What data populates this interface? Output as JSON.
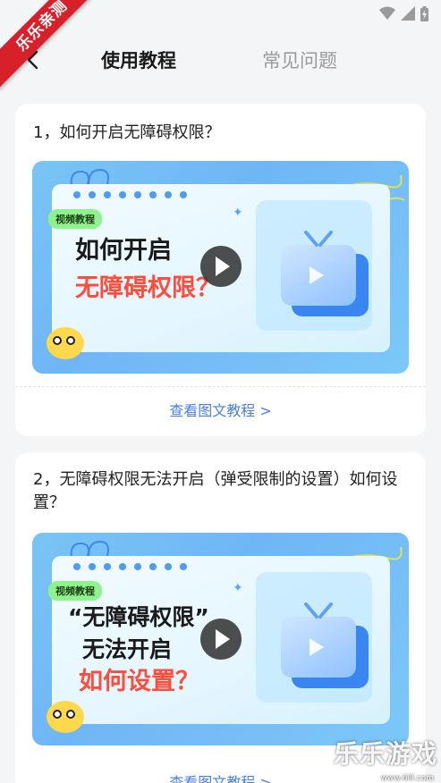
{
  "watermark": {
    "ribbon": "乐乐亲测",
    "bottom_right": "乐乐游戏",
    "bottom_right_url": "www.6ill.com"
  },
  "status_bar": {
    "icons": [
      "wifi-icon",
      "signal-icon",
      "battery-icon"
    ]
  },
  "tabs": [
    {
      "label": "使用教程",
      "active": true
    },
    {
      "label": "常见问题",
      "active": false
    }
  ],
  "cards": [
    {
      "question": "1，如何开启无障碍权限？",
      "thumbnail": {
        "tag": "视频教程",
        "lines": [
          {
            "text": "如何开启",
            "color": "black"
          },
          {
            "text": "无障碍权限？",
            "color": "red"
          }
        ]
      },
      "link": "查看图文教程 >"
    },
    {
      "question": "2，无障碍权限无法开启（弹受限制的设置）如何设置？",
      "thumbnail": {
        "tag": "视频教程",
        "lines": [
          {
            "text": "“无障碍权限”",
            "color": "black"
          },
          {
            "text": "无法开启",
            "color": "black"
          },
          {
            "text": "如何设置？",
            "color": "red"
          }
        ]
      },
      "link": "查看图文教程 >"
    }
  ],
  "colors": {
    "accent": "#4a7fe0",
    "highlight_red": "#ff4d3d",
    "tag_green": "#8ef38c",
    "thumb_blue": "#79c5f5"
  }
}
